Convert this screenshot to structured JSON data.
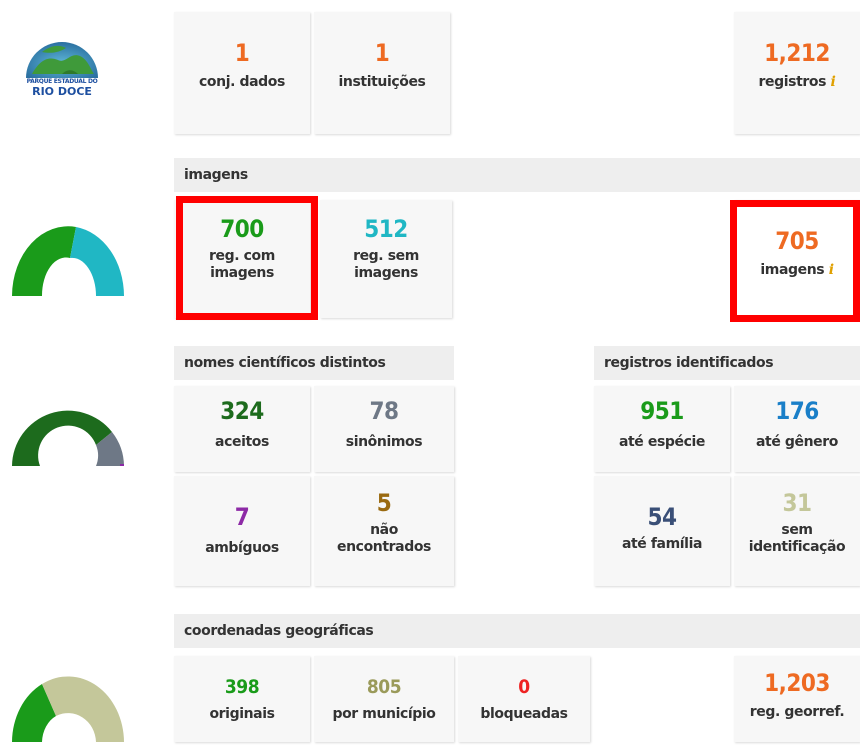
{
  "logo": {
    "line1": "PARQUE ESTADUAL DO",
    "line2": "RIO DOCE"
  },
  "colors": {
    "orange": "#ee6a22",
    "green": "#1a9b1a",
    "cyan": "#20b7c4",
    "dark_green": "#1d6b1d",
    "slate": "#6e7886",
    "purple": "#8d2aa6",
    "brown": "#9a6a10",
    "navy": "#3a4f77",
    "blue": "#1a7fc8",
    "beige": "#c4c79a",
    "olive": "#9a9a5a",
    "red": "#ee2222",
    "highlight": "#ff0000"
  },
  "summary": {
    "datasets": {
      "value": "1",
      "label": "conj. dados"
    },
    "institutions": {
      "value": "1",
      "label": "instituições"
    },
    "records": {
      "value": "1,212",
      "label": "registros",
      "info": "i"
    }
  },
  "images": {
    "title": "imagens",
    "with_images": {
      "value": "700",
      "label_1": "reg. com",
      "label_2": "imagens"
    },
    "without_images": {
      "value": "512",
      "label_1": "reg. sem",
      "label_2": "imagens"
    },
    "total": {
      "value": "705",
      "label": "imagens",
      "info": "i"
    },
    "gauge": [
      {
        "name": "reg. com imagens",
        "value": 700,
        "color": "#1a9b1a"
      },
      {
        "name": "reg. sem imagens",
        "value": 512,
        "color": "#20b7c4"
      }
    ]
  },
  "names": {
    "title": "nomes científicos distintos",
    "accepted": {
      "value": "324",
      "label": "aceitos"
    },
    "synonyms": {
      "value": "78",
      "label": "sinônimos"
    },
    "ambiguous": {
      "value": "7",
      "label": "ambíguos"
    },
    "not_found": {
      "value": "5",
      "label_1": "não",
      "label_2": "encontrados"
    },
    "gauge": [
      {
        "name": "aceitos",
        "value": 324,
        "color": "#1d6b1d"
      },
      {
        "name": "sinônimos",
        "value": 78,
        "color": "#6e7886"
      },
      {
        "name": "ambíguos",
        "value": 7,
        "color": "#8d2aa6"
      },
      {
        "name": "não encontrados",
        "value": 5,
        "color": "#9a6a10"
      }
    ]
  },
  "identified": {
    "title": "registros identificados",
    "species": {
      "value": "951",
      "label": "até espécie"
    },
    "genus": {
      "value": "176",
      "label": "até gênero"
    },
    "family": {
      "value": "54",
      "label": "até família"
    },
    "none": {
      "value": "31",
      "label_1": "sem",
      "label_2": "identificação"
    }
  },
  "coords": {
    "title": "coordenadas geográficas",
    "original": {
      "value": "398",
      "label": "originais"
    },
    "by_municipality": {
      "value": "805",
      "label": "por município"
    },
    "blocked": {
      "value": "0",
      "label": "bloqueadas"
    },
    "georeferenced": {
      "value": "1,203",
      "label": "reg. georref."
    },
    "gauge": [
      {
        "name": "originais",
        "value": 398,
        "color": "#1a9b1a"
      },
      {
        "name": "por município",
        "value": 805,
        "color": "#c4c79a"
      },
      {
        "name": "bloqueadas",
        "value": 0,
        "color": "#ee2222"
      }
    ]
  }
}
